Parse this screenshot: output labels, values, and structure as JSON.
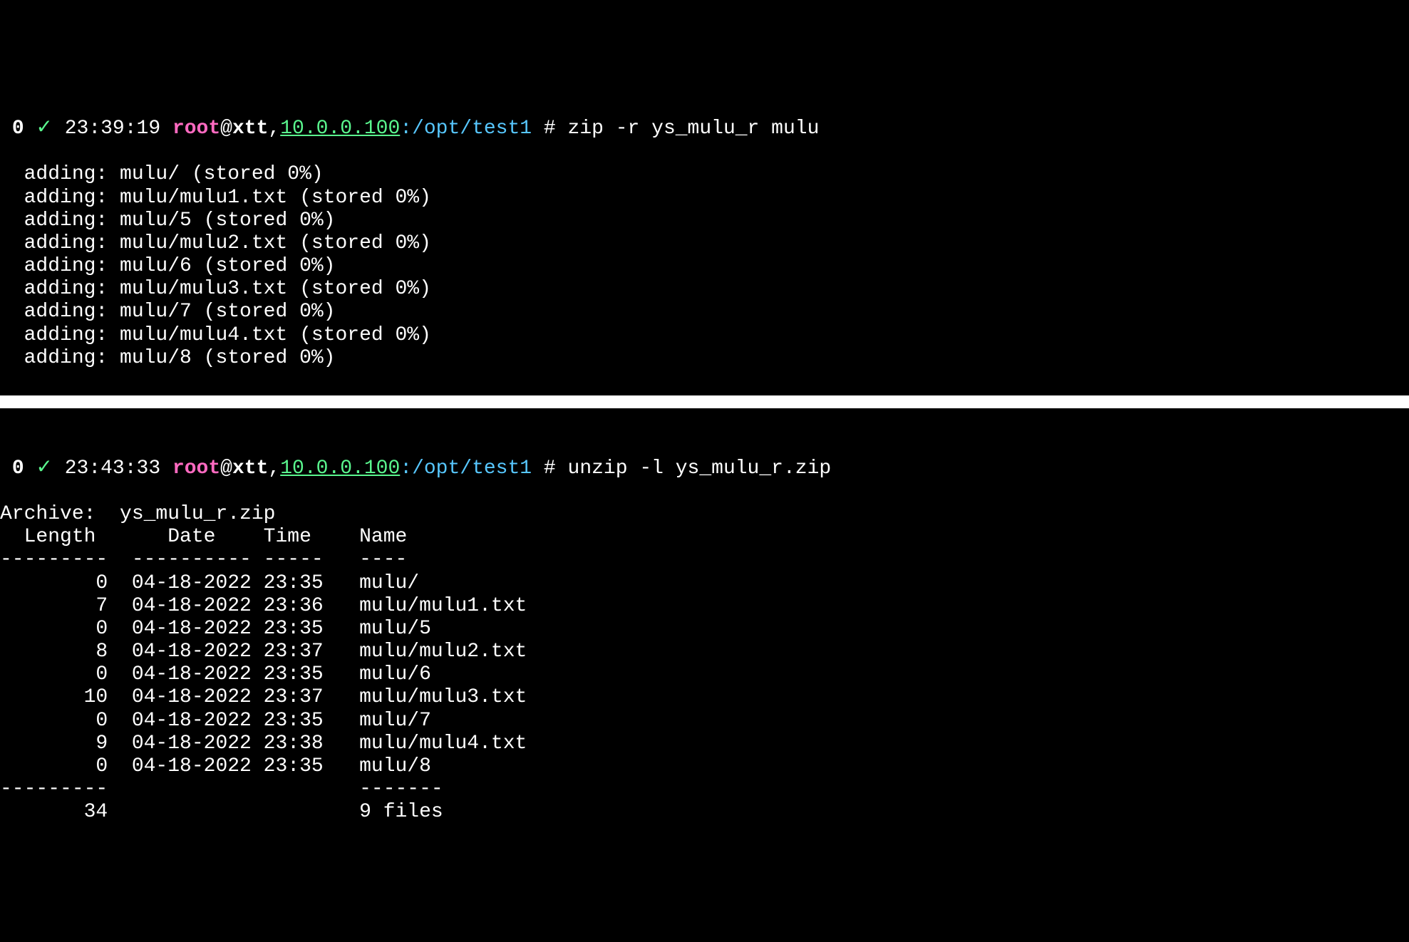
{
  "block1": {
    "prompt": {
      "num": "0",
      "check": "✓",
      "time": "23:39:19",
      "user": "root",
      "at": "@",
      "host": "xtt",
      "comma": ",",
      "ip": "10.0.0.100",
      "colon": ":",
      "path": "/opt/test1",
      "hash": " # ",
      "cmd": "zip -r ys_mulu_r mulu"
    },
    "output_lines": [
      "  adding: mulu/ (stored 0%)",
      "  adding: mulu/mulu1.txt (stored 0%)",
      "  adding: mulu/5 (stored 0%)",
      "  adding: mulu/mulu2.txt (stored 0%)",
      "  adding: mulu/6 (stored 0%)",
      "  adding: mulu/mulu3.txt (stored 0%)",
      "  adding: mulu/7 (stored 0%)",
      "  adding: mulu/mulu4.txt (stored 0%)",
      "  adding: mulu/8 (stored 0%)"
    ]
  },
  "block2": {
    "prompt": {
      "num": "0",
      "check": "✓",
      "time": "23:43:33",
      "user": "root",
      "at": "@",
      "host": "xtt",
      "comma": ",",
      "ip": "10.0.0.100",
      "colon": ":",
      "path": "/opt/test1",
      "hash": " # ",
      "cmd": "unzip -l ys_mulu_r.zip"
    },
    "archive_line": "Archive:  ys_mulu_r.zip",
    "header": "  Length      Date    Time    Name",
    "header_sep": "---------  ---------- -----   ----",
    "rows": [
      "        0  04-18-2022 23:35   mulu/",
      "        7  04-18-2022 23:36   mulu/mulu1.txt",
      "        0  04-18-2022 23:35   mulu/5",
      "        8  04-18-2022 23:37   mulu/mulu2.txt",
      "        0  04-18-2022 23:35   mulu/6",
      "       10  04-18-2022 23:37   mulu/mulu3.txt",
      "        0  04-18-2022 23:35   mulu/7",
      "        9  04-18-2022 23:38   mulu/mulu4.txt",
      "        0  04-18-2022 23:35   mulu/8"
    ],
    "footer_sep": "---------                     -------",
    "footer": "       34                     9 files"
  }
}
